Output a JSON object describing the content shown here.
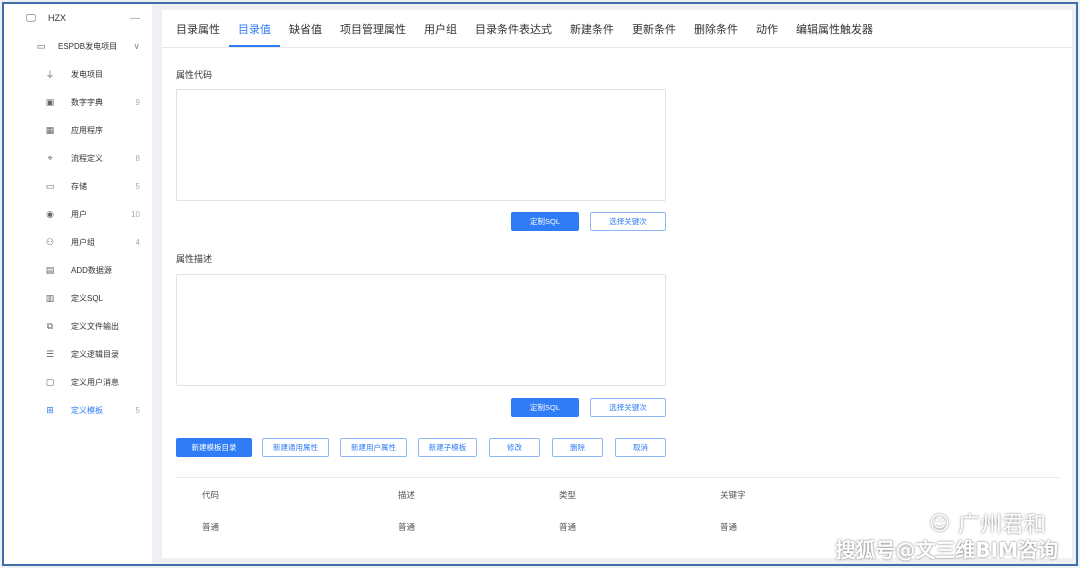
{
  "sidebar": {
    "root": {
      "label": "HZX",
      "icon": "monitor-icon",
      "collapse": "—"
    },
    "group": {
      "label": "ESPDB发电项目",
      "icon": "chart-icon",
      "chevron": "∨"
    },
    "items": [
      {
        "label": "发电项目",
        "count": "",
        "icon": "plug-icon",
        "glyph": "⏚"
      },
      {
        "label": "数字字典",
        "count": "9",
        "icon": "dictionary-icon",
        "glyph": "▣"
      },
      {
        "label": "应用程序",
        "count": "",
        "icon": "grid-icon",
        "glyph": "▦"
      },
      {
        "label": "流程定义",
        "count": "8",
        "icon": "flow-icon",
        "glyph": "⌖"
      },
      {
        "label": "存储",
        "count": "5",
        "icon": "storage-icon",
        "glyph": "▭"
      },
      {
        "label": "用户",
        "count": "10",
        "icon": "user-icon",
        "glyph": "◉"
      },
      {
        "label": "用户组",
        "count": "4",
        "icon": "user-group-icon",
        "glyph": "⚇"
      },
      {
        "label": "ADD数据源",
        "count": "",
        "icon": "datasource-icon",
        "glyph": "▤"
      },
      {
        "label": "定义SQL",
        "count": "",
        "icon": "sql-icon",
        "glyph": "▥"
      },
      {
        "label": "定义文件输出",
        "count": "",
        "icon": "file-output-icon",
        "glyph": "⧉"
      },
      {
        "label": "定义逻辑目录",
        "count": "",
        "icon": "list-icon",
        "glyph": "☰"
      },
      {
        "label": "定义用户消息",
        "count": "",
        "icon": "message-icon",
        "glyph": "▢"
      },
      {
        "label": "定义模板",
        "count": "5",
        "icon": "template-icon",
        "glyph": "⊞"
      }
    ]
  },
  "tabs": [
    "目录属性",
    "目录值",
    "缺省值",
    "项目管理属性",
    "用户组",
    "目录条件表达式",
    "新建条件",
    "更新条件",
    "删除条件",
    "动作",
    "编辑属性触发器"
  ],
  "active_tab": "目录值",
  "form": {
    "code_label": "属性代码",
    "desc_label": "属性描述",
    "define_sql": "定制SQL",
    "select_keyword": "选择关键次"
  },
  "actions": {
    "new_template_dir": "新建模板目录",
    "new_common_attr": "新建通用属性",
    "new_user_attr": "新建用户属性",
    "new_child_template": "新建子模板",
    "edit": "修改",
    "delete": "删除",
    "cancel": "取消"
  },
  "table": {
    "headers": [
      "代码",
      "描述",
      "类型",
      "关键字"
    ],
    "rows": [
      [
        "普通",
        "普通",
        "普通",
        "普通"
      ]
    ]
  },
  "watermark": {
    "line1": "广州君和",
    "line2": "搜狐号@文三维BIM咨询"
  },
  "colors": {
    "accent": "#2f7cf6",
    "frame": "#3d6fa8"
  }
}
